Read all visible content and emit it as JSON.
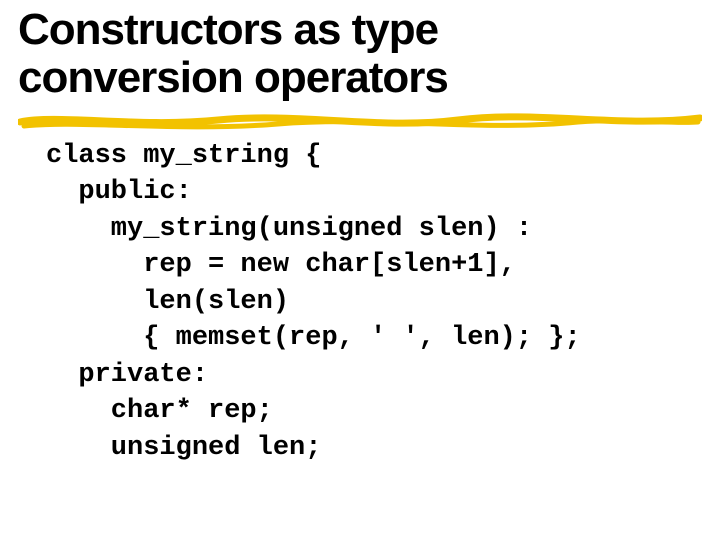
{
  "title": {
    "line1": "Constructors as type",
    "line2": "conversion operators"
  },
  "code": {
    "l1": "class my_string {",
    "l2": "  public:",
    "l3": "    my_string(unsigned slen) :",
    "l4": "      rep = new char[slen+1],",
    "l5": "      len(slen)",
    "l6": "      { memset(rep, ' ', len); };",
    "l7": "  private:",
    "l8": "    char* rep;",
    "l9": "    unsigned len;"
  }
}
